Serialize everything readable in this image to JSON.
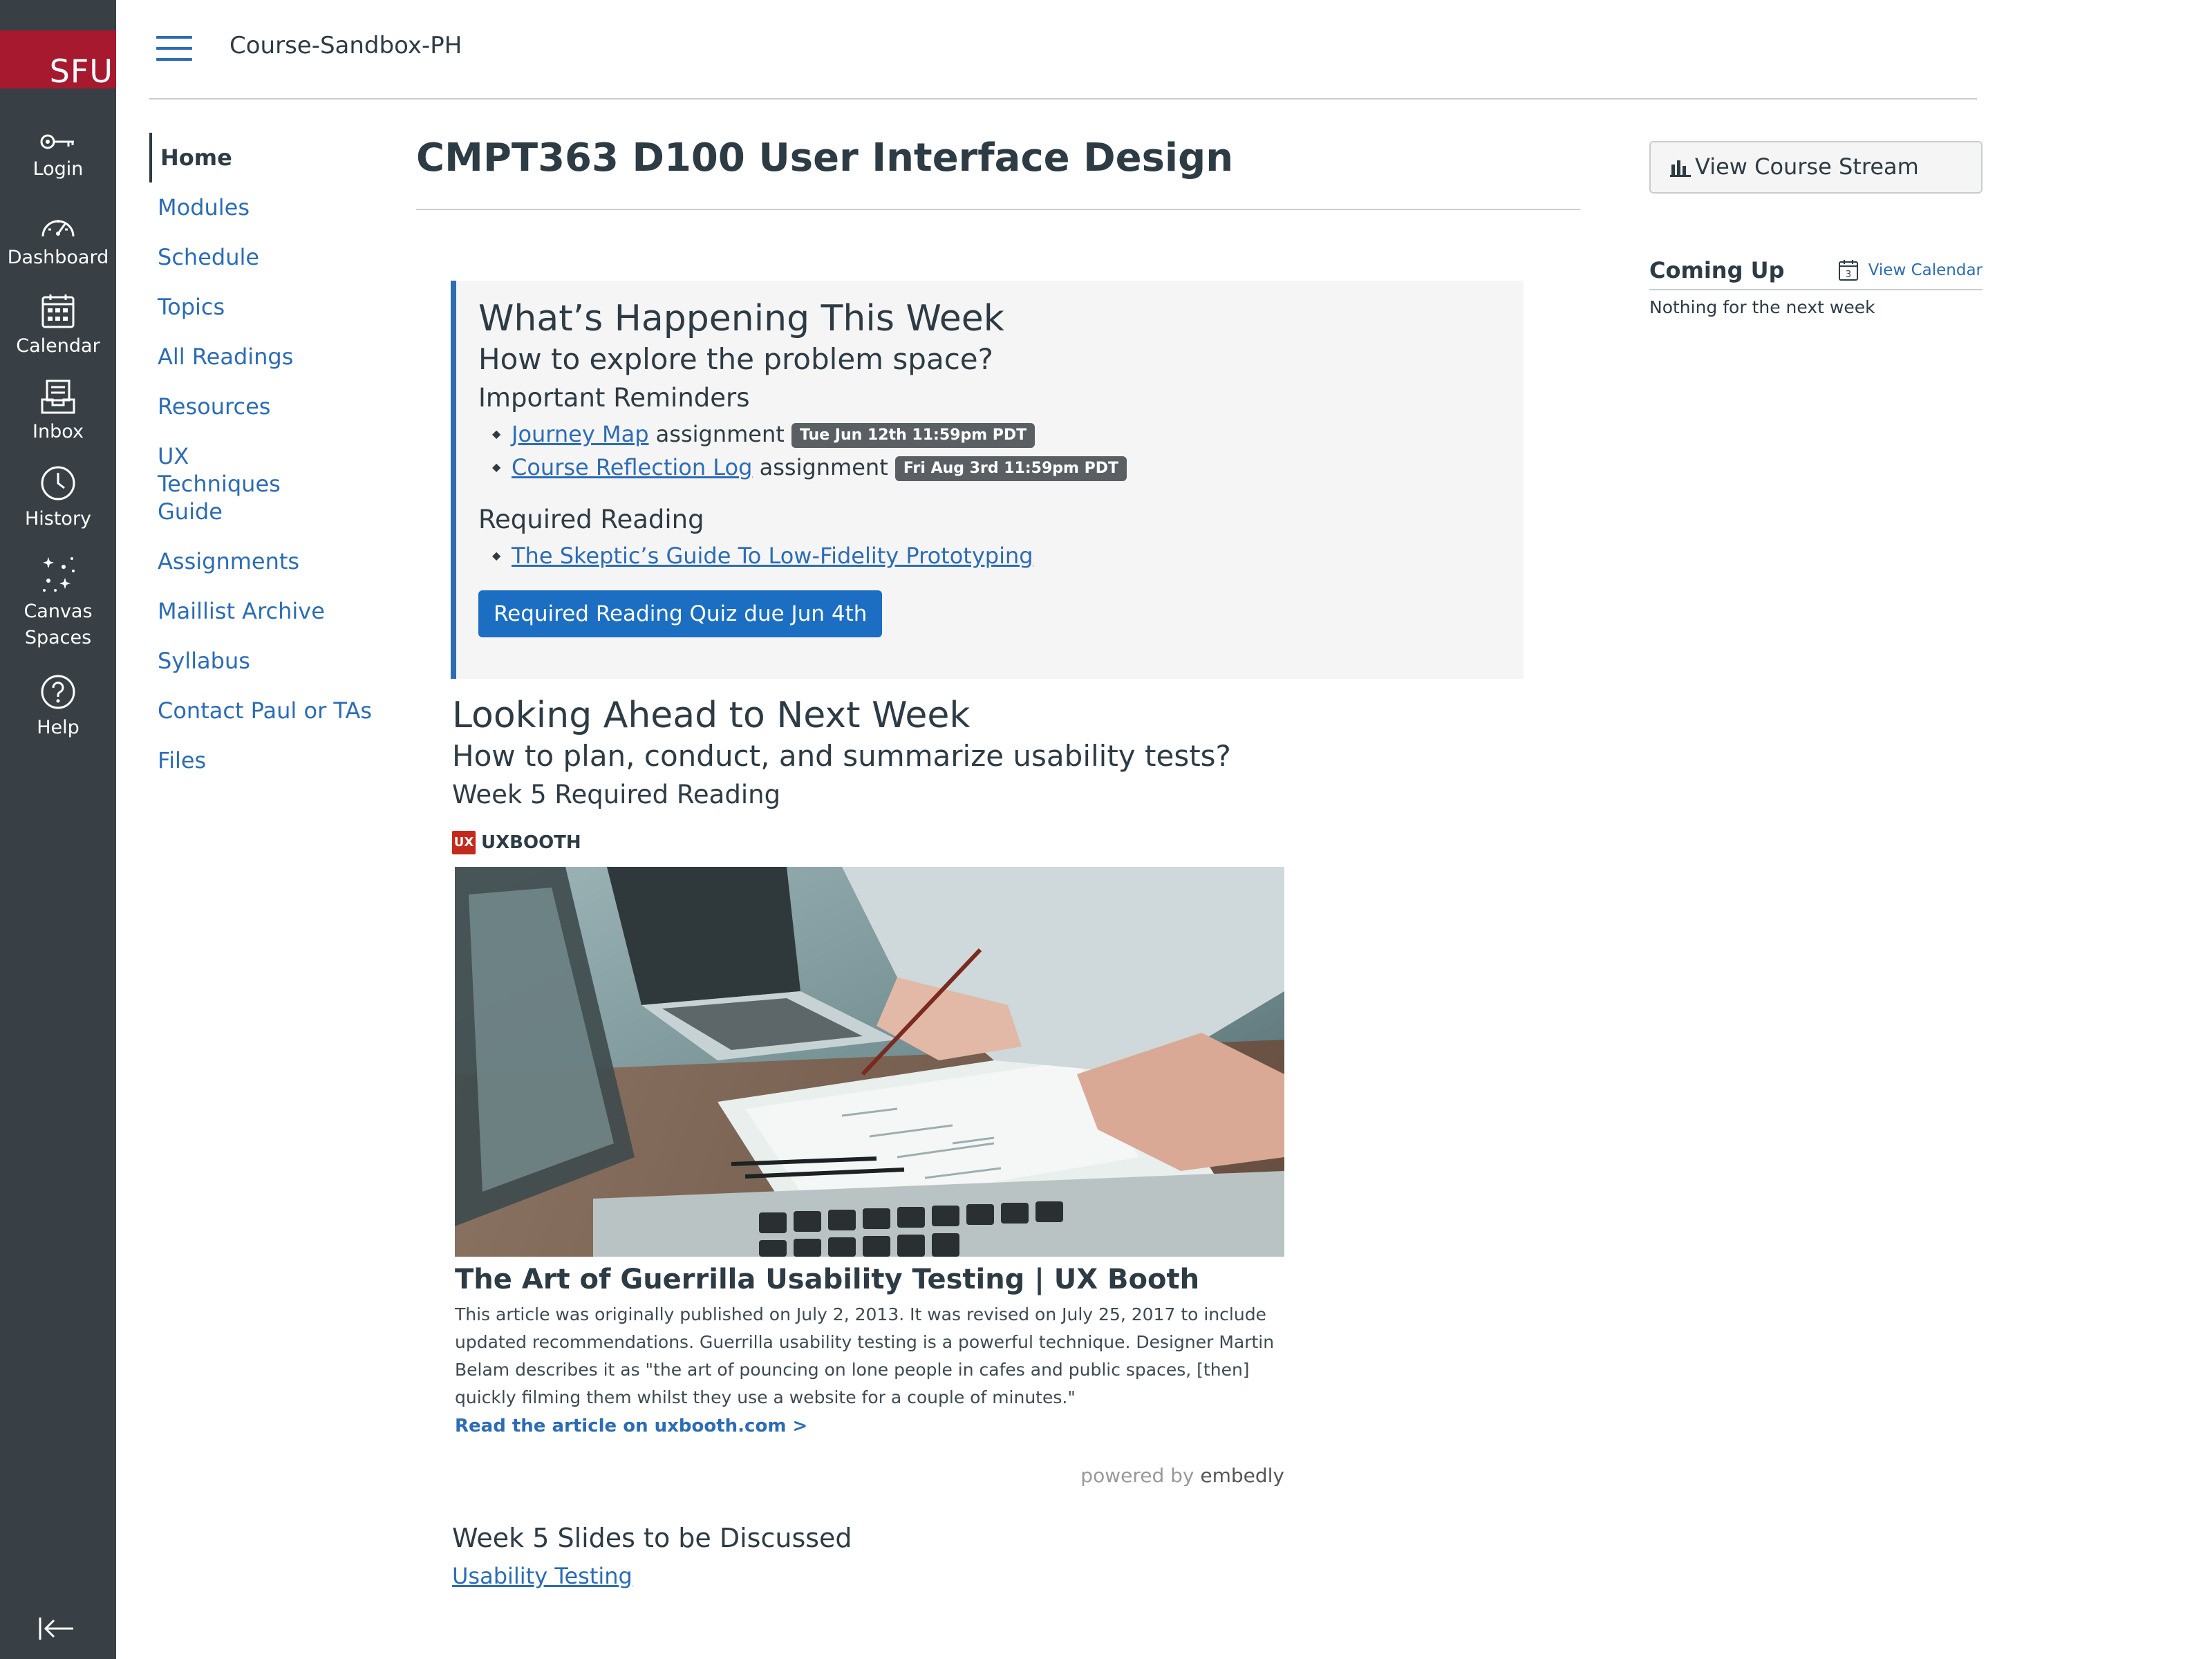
{
  "global_nav": {
    "logo_text": "SFU",
    "items": [
      {
        "label": "Login",
        "icon": "key-icon"
      },
      {
        "label": "Dashboard",
        "icon": "dashboard-icon"
      },
      {
        "label": "Calendar",
        "icon": "calendar-icon"
      },
      {
        "label": "Inbox",
        "icon": "inbox-icon"
      },
      {
        "label": "History",
        "icon": "clock-icon"
      },
      {
        "label": "Canvas Spaces",
        "icon": "sparkle-icon"
      },
      {
        "label": "Help",
        "icon": "help-icon"
      }
    ],
    "collapse_icon": "collapse-nav-icon"
  },
  "header": {
    "breadcrumb": "Course-Sandbox-PH"
  },
  "course_nav": {
    "items": [
      "Home",
      "Modules",
      "Schedule",
      "Topics",
      "All Readings",
      "Resources",
      "UX Techniques Guide",
      "Assignments",
      "Maillist Archive",
      "Syllabus",
      "Contact Paul or TAs",
      "Files"
    ],
    "active": "Home"
  },
  "main": {
    "title": "CMPT363 D100 User Interface Design",
    "this_week": {
      "heading": "What’s Happening This Week",
      "question": "How to explore the problem space?",
      "reminders_heading": "Important Reminders",
      "reminders": [
        {
          "link": "Journey Map",
          "suffix": "assignment",
          "due": "Tue Jun 12th 11:59pm PDT"
        },
        {
          "link": "Course Reflection Log",
          "suffix": "assignment",
          "due": "Fri Aug 3rd 11:59pm PDT"
        }
      ],
      "reading_heading": "Required Reading",
      "reading_link": "The Skeptic’s Guide To Low-Fidelity Prototyping",
      "quiz_button": "Required Reading Quiz due Jun 4th"
    },
    "next_week": {
      "heading": "Looking Ahead to Next Week",
      "question": "How to plan, conduct, and summarize usability tests?",
      "reading_heading": "Week 5 Required Reading",
      "embed": {
        "source_logo": "UX",
        "source": "UXBOOTH",
        "title": "The Art of Guerrilla Usability Testing | UX Booth",
        "description": "This article was originally published on July 2, 2013. It was revised on July 25, 2017 to include updated recommendations. Guerrilla usability testing is a powerful technique. Designer Martin Belam describes it as \"the art of pouncing on lone people in cafes and public spaces, [then] quickly filming them whilst they use a website for a couple of minutes.\"",
        "read_more": "Read the article on uxbooth.com >",
        "powered_by": "powered by",
        "powered_brand": "embedly"
      },
      "slides_heading": "Week 5 Slides to be Discussed",
      "slides_link": "Usability Testing"
    }
  },
  "sidebar": {
    "stream_button": "View Course Stream",
    "coming_up_title": "Coming Up",
    "view_calendar": "View Calendar",
    "calendar_day": "3",
    "empty_text": "Nothing for the next week"
  },
  "colors": {
    "nav_bg": "#394045",
    "brand_red": "#a6192e",
    "link": "#2c6cb5",
    "button": "#1b6ec2"
  }
}
